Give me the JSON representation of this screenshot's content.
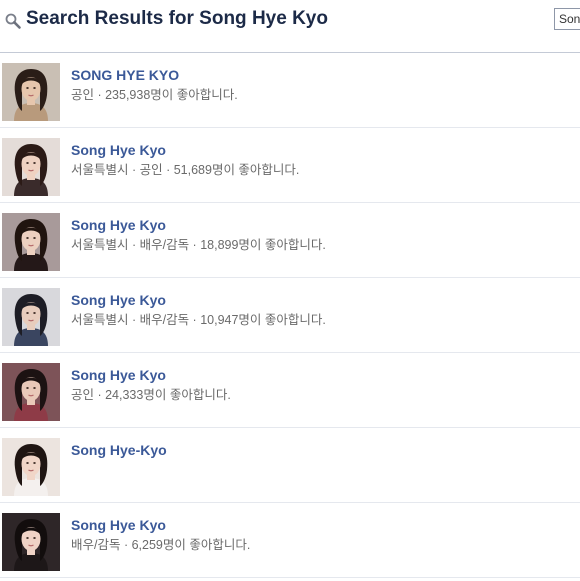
{
  "header": {
    "title": "Search Results for Song Hye Kyo",
    "search_value": "Son"
  },
  "results": [
    {
      "name": "SONG HYE KYO",
      "meta": "공인 · 235,938명이 좋아합니다.",
      "thumb_bg": "#c9bfb4",
      "thumb_hair": "#2a1d17",
      "thumb_skin": "#e6c6ad",
      "thumb_cloth": "#b89a7c"
    },
    {
      "name": "Song Hye Kyo",
      "meta": "서울특별시 · 공인 · 51,689명이 좋아합니다.",
      "thumb_bg": "#e4dcd8",
      "thumb_hair": "#2b1a16",
      "thumb_skin": "#efd2c2",
      "thumb_cloth": "#3a2b2b"
    },
    {
      "name": "Song Hye Kyo",
      "meta": "서울특별시 · 배우/감독 · 18,899명이 좋아합니다.",
      "thumb_bg": "#a89a9a",
      "thumb_hair": "#20140f",
      "thumb_skin": "#ecd0c0",
      "thumb_cloth": "#241818"
    },
    {
      "name": "Song Hye Kyo",
      "meta": "서울특별시 · 배우/감독 · 10,947명이 좋아합니다.",
      "thumb_bg": "#d8d8dc",
      "thumb_hair": "#1d1d25",
      "thumb_skin": "#e8cdbd",
      "thumb_cloth": "#3a4560"
    },
    {
      "name": "Song Hye Kyo",
      "meta": "공인 · 24,333명이 좋아합니다.",
      "thumb_bg": "#7d5358",
      "thumb_hair": "#1c1212",
      "thumb_skin": "#e9c9b9",
      "thumb_cloth": "#8e3b47"
    },
    {
      "name": "Song Hye-Kyo",
      "meta": "",
      "thumb_bg": "#ece4df",
      "thumb_hair": "#1f1512",
      "thumb_skin": "#f1d6c8",
      "thumb_cloth": "#f4f0ee"
    },
    {
      "name": "Song Hye Kyo",
      "meta": "배우/감독 · 6,259명이 좋아합니다.",
      "thumb_bg": "#2e2628",
      "thumb_hair": "#120d0d",
      "thumb_skin": "#efd3c6",
      "thumb_cloth": "#1d1718"
    }
  ]
}
